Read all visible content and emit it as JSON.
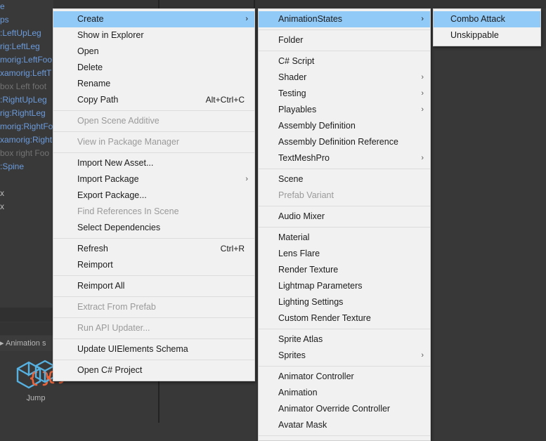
{
  "background": {
    "hierarchy_rows": [
      {
        "text": "e",
        "style": "link"
      },
      {
        "text": "ps",
        "style": "link"
      },
      {
        "text": ":LeftUpLeg",
        "style": "link"
      },
      {
        "text": "rig:LeftLeg",
        "style": "link"
      },
      {
        "text": "morig:LeftFoo",
        "style": "link"
      },
      {
        "text": "xamorig:LeftT",
        "style": "link"
      },
      {
        "text": "box Left foot",
        "style": "dim"
      },
      {
        "text": ":RightUpLeg",
        "style": "link"
      },
      {
        "text": "rig:RightLeg",
        "style": "link"
      },
      {
        "text": "morig:RightFo",
        "style": "link"
      },
      {
        "text": "xamorig:Right",
        "style": "link"
      },
      {
        "text": "box right Foo",
        "style": "dim"
      },
      {
        "text": ":Spine",
        "style": "link"
      },
      {
        "text": "",
        "style": "link"
      },
      {
        "text": "x",
        "style": "x"
      },
      {
        "text": "x",
        "style": "x"
      }
    ],
    "animation_tab_label": "Animation s",
    "assets": [
      {
        "label": "Jump",
        "icon": "prefab-cube-icon"
      },
      {
        "label": ".",
        "icon": "prefab-cube-icon"
      }
    ]
  },
  "context_menu": {
    "name": "project-context-menu",
    "items": [
      {
        "label": "Create",
        "submenu": true,
        "selected": true
      },
      {
        "label": "Show in Explorer"
      },
      {
        "label": "Open"
      },
      {
        "label": "Delete"
      },
      {
        "label": "Rename"
      },
      {
        "label": "Copy Path",
        "shortcut": "Alt+Ctrl+C"
      },
      {
        "separator": true
      },
      {
        "label": "Open Scene Additive",
        "disabled": true
      },
      {
        "separator": true
      },
      {
        "label": "View in Package Manager",
        "disabled": true
      },
      {
        "separator": true
      },
      {
        "label": "Import New Asset..."
      },
      {
        "label": "Import Package",
        "submenu": true
      },
      {
        "label": "Export Package..."
      },
      {
        "label": "Find References In Scene",
        "disabled": true
      },
      {
        "label": "Select Dependencies"
      },
      {
        "separator": true
      },
      {
        "label": "Refresh",
        "shortcut": "Ctrl+R"
      },
      {
        "label": "Reimport"
      },
      {
        "separator": true
      },
      {
        "label": "Reimport All"
      },
      {
        "separator": true
      },
      {
        "label": "Extract From Prefab",
        "disabled": true
      },
      {
        "separator": true
      },
      {
        "label": "Run API Updater...",
        "disabled": true
      },
      {
        "separator": true
      },
      {
        "label": "Update UIElements Schema"
      },
      {
        "separator": true
      },
      {
        "label": "Open C# Project"
      }
    ]
  },
  "create_menu": {
    "name": "create-submenu",
    "items": [
      {
        "label": "AnimationStates",
        "submenu": true,
        "selected": true
      },
      {
        "separator": true
      },
      {
        "label": "Folder"
      },
      {
        "separator": true
      },
      {
        "label": "C# Script"
      },
      {
        "label": "Shader",
        "submenu": true
      },
      {
        "label": "Testing",
        "submenu": true
      },
      {
        "label": "Playables",
        "submenu": true
      },
      {
        "label": "Assembly Definition"
      },
      {
        "label": "Assembly Definition Reference"
      },
      {
        "label": "TextMeshPro",
        "submenu": true
      },
      {
        "separator": true
      },
      {
        "label": "Scene"
      },
      {
        "label": "Prefab Variant",
        "disabled": true
      },
      {
        "separator": true
      },
      {
        "label": "Audio Mixer"
      },
      {
        "separator": true
      },
      {
        "label": "Material"
      },
      {
        "label": "Lens Flare"
      },
      {
        "label": "Render Texture"
      },
      {
        "label": "Lightmap Parameters"
      },
      {
        "label": "Lighting Settings"
      },
      {
        "label": "Custom Render Texture"
      },
      {
        "separator": true
      },
      {
        "label": "Sprite Atlas"
      },
      {
        "label": "Sprites",
        "submenu": true
      },
      {
        "separator": true
      },
      {
        "label": "Animator Controller"
      },
      {
        "label": "Animation"
      },
      {
        "label": "Animator Override Controller"
      },
      {
        "label": "Avatar Mask"
      },
      {
        "separator": true
      }
    ]
  },
  "animationstates_menu": {
    "name": "animationstates-submenu",
    "items": [
      {
        "label": "Combo Attack",
        "selected": true
      },
      {
        "label": "Unskippable"
      }
    ]
  },
  "icons": {
    "submenu_arrow": "chevron-right-icon"
  },
  "colors": {
    "menu_bg": "#f1f1f1",
    "menu_border": "#cfcfcf",
    "highlight": "#91c9f7",
    "text": "#1b1b1b",
    "text_disabled": "#9a9a9a",
    "separator": "#dcdcdc",
    "editor_bg": "#383838",
    "hierarchy_link": "#6b9bdc",
    "prefab_blue": "#56b0e0",
    "prefab_orange": "#e8633a"
  }
}
